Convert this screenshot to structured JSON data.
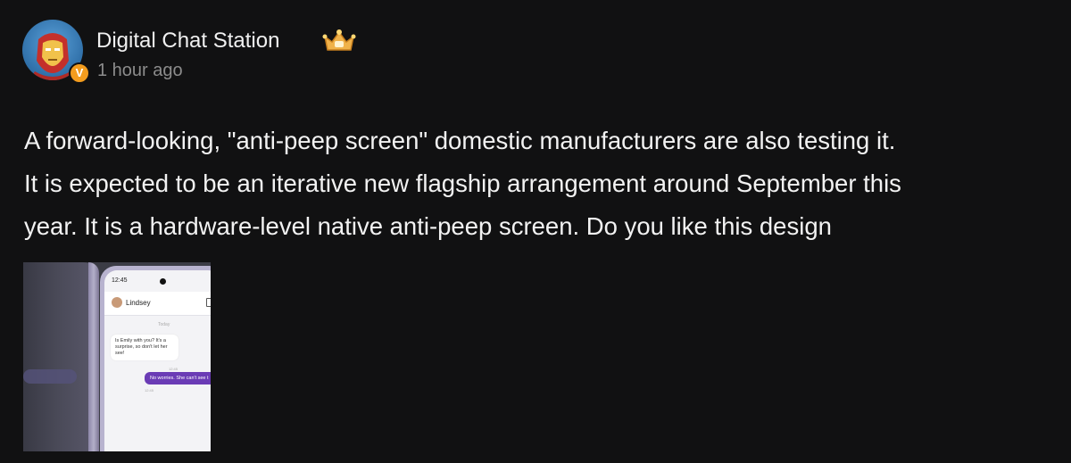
{
  "post": {
    "author": "Digital Chat Station",
    "timestamp": "1 hour ago",
    "verified_badge": "V",
    "text_lines": [
      "A forward-looking, \"anti-peep screen\" domestic manufacturers are also testing it.",
      "It is expected to be an iterative new flagship arrangement around September this",
      "year. It is a hardware-level native anti-peep screen. Do you like this design"
    ]
  },
  "image": {
    "status_time": "12:45",
    "contact_name": "Lindsey",
    "day_label": "Today",
    "incoming_message": "Is Emily with you? It's a surprise, so don't let her see!",
    "incoming_time": "12:45",
    "outgoing_message": "No worries. She can't see t",
    "outgoing_time": "12:45"
  },
  "colors": {
    "background": "#111112",
    "text": "#f2f2f2",
    "muted": "#8c8c8c",
    "verified": "#f39c1e",
    "crown": "#f0b24a"
  },
  "icons": {
    "avatar": "iron-man-avatar",
    "badge": "crown-icon",
    "verified": "verified-icon"
  }
}
